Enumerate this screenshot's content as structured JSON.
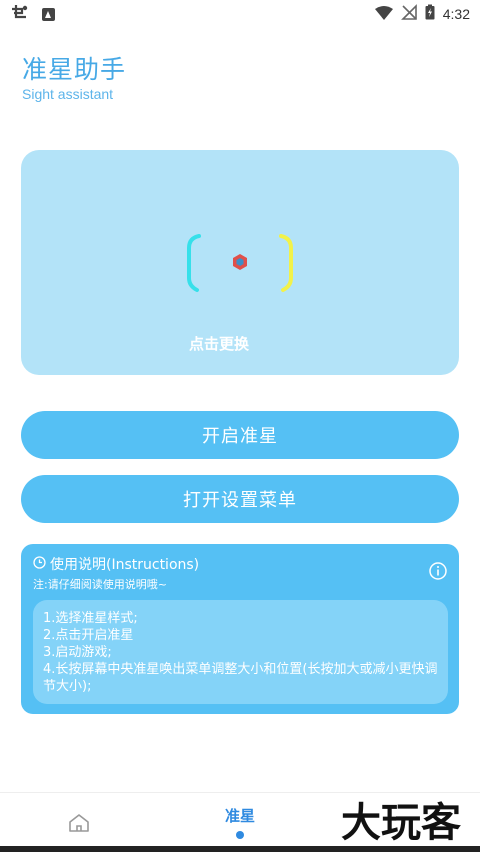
{
  "status_bar": {
    "time": "4:32",
    "icons": [
      "app-notification-icon",
      "a-notification-icon",
      "wifi-icon",
      "no-signal-icon",
      "battery-charging-icon"
    ]
  },
  "header": {
    "title": "准星助手",
    "subtitle": "Sight assistant"
  },
  "preview": {
    "label": "点击更换",
    "colors": {
      "card": "#b3e3f8",
      "bracket_left": "#36e0ea",
      "bracket_right": "#f2f24a",
      "center": "#e0504a"
    }
  },
  "buttons": {
    "open_crosshair": "开启准星",
    "open_menu": "打开设置菜单"
  },
  "instructions": {
    "heading": "使用说明(Instructions)",
    "note": "注:请仔细阅读使用说明哦~",
    "steps": [
      "1.选择准星样式;",
      "2.点击开启准星",
      "3.启动游戏;",
      "4.长按屏幕中央准星唤出菜单调整大小和位置(长按加大或减小更快调节大小);"
    ]
  },
  "bottom_nav": {
    "active_label": "准星",
    "items": [
      "home-icon",
      "准星"
    ]
  },
  "watermark": {
    "text": "大玩客"
  },
  "theme": {
    "accent": "#55c0f4",
    "title_color": "#47a9e6",
    "nav_active": "#2f8ae0"
  }
}
